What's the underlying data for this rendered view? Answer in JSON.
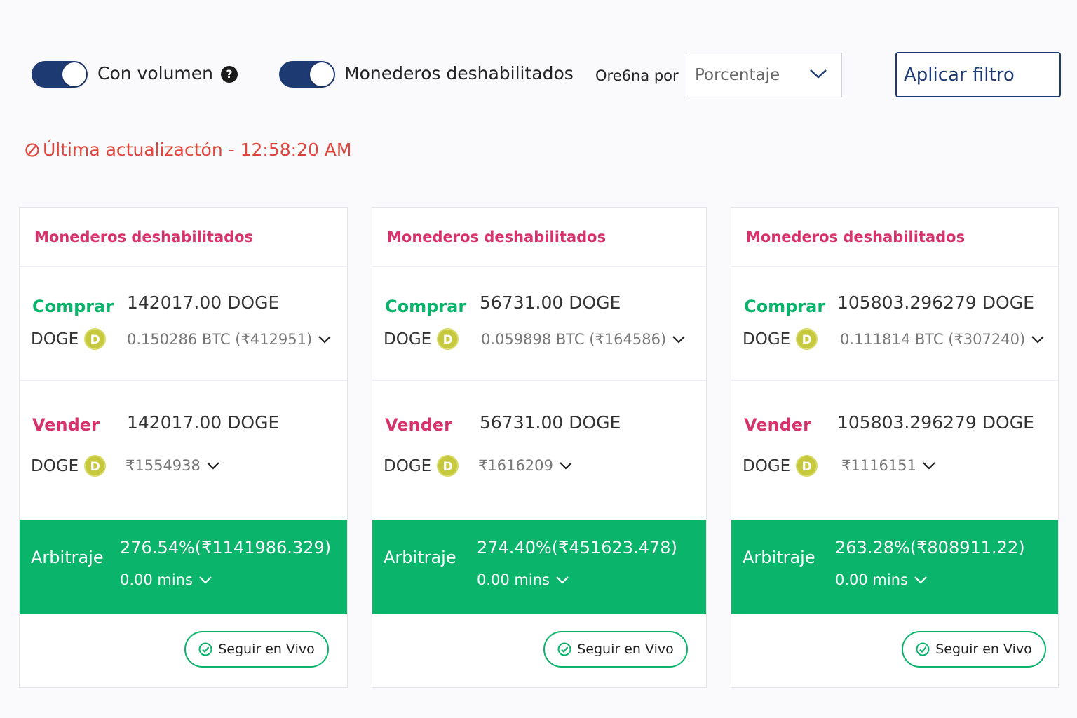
{
  "filters": {
    "volume_label": "Con volumen",
    "disabled_wallets_label": "Monederos deshabilitados",
    "sort_label": "Ore6na por",
    "sort_value": "Porcentaje",
    "apply_label": "Aplicar filtro"
  },
  "last_update": "Última actualizactón - 12:58:20 AM",
  "labels": {
    "buy": "Comprar",
    "sell": "Vender",
    "arbitrage": "Arbitraje",
    "follow": "Seguir en Vivo",
    "coin": "DOGE",
    "coin_symbol": "D"
  },
  "colors": {
    "accent": "#1e3a73",
    "buy": "#0ab46b",
    "sell": "#d6336c",
    "alert": "#e0453c",
    "arbitrage_bg": "#0bb46b"
  },
  "cards": [
    {
      "title": "Monederos deshabilitados",
      "buy_amount": "142017.00 DOGE",
      "buy_detail": "0.150286 BTC (₹412951)",
      "sell_amount": "142017.00 DOGE",
      "sell_detail": "₹1554938",
      "arbitrage": "276.54%(₹1141986.329)",
      "mins": "0.00 mins"
    },
    {
      "title": "Monederos deshabilitados",
      "buy_amount": "56731.00 DOGE",
      "buy_detail": "0.059898 BTC (₹164586)",
      "sell_amount": "56731.00 DOGE",
      "sell_detail": "₹1616209",
      "arbitrage": "274.40%(₹451623.478)",
      "mins": "0.00 mins"
    },
    {
      "title": "Monederos deshabilitados",
      "buy_amount": "105803.296279 DOGE",
      "buy_detail": "0.111814 BTC (₹307240)",
      "sell_amount": "105803.296279 DOGE",
      "sell_detail": "₹1116151",
      "arbitrage": "263.28%(₹808911.22)",
      "mins": "0.00 mins"
    }
  ]
}
